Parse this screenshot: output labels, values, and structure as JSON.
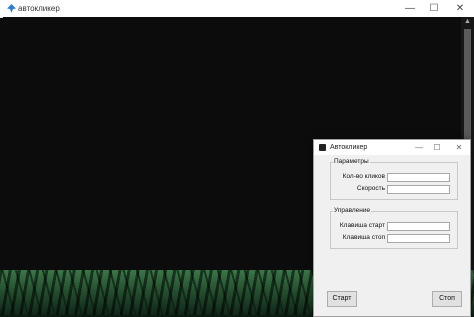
{
  "console": {
    "title": "автокликер",
    "icon": "pin-icon",
    "controls": [
      "—",
      "☐",
      "✕"
    ]
  },
  "dialog": {
    "title": "Автокликер",
    "controls": [
      "—",
      "☐",
      "✕"
    ],
    "params_group": {
      "label": "Параметры",
      "fields": [
        {
          "label": "Кол-во кликов",
          "value": ""
        },
        {
          "label": "Скорость",
          "value": ""
        }
      ]
    },
    "control_group": {
      "label": "Управление",
      "fields": [
        {
          "label": "Клавиша старт",
          "value": ""
        },
        {
          "label": "Клавиша стоп",
          "value": ""
        }
      ]
    },
    "start_label": "Старт",
    "stop_label": "Стоп"
  }
}
